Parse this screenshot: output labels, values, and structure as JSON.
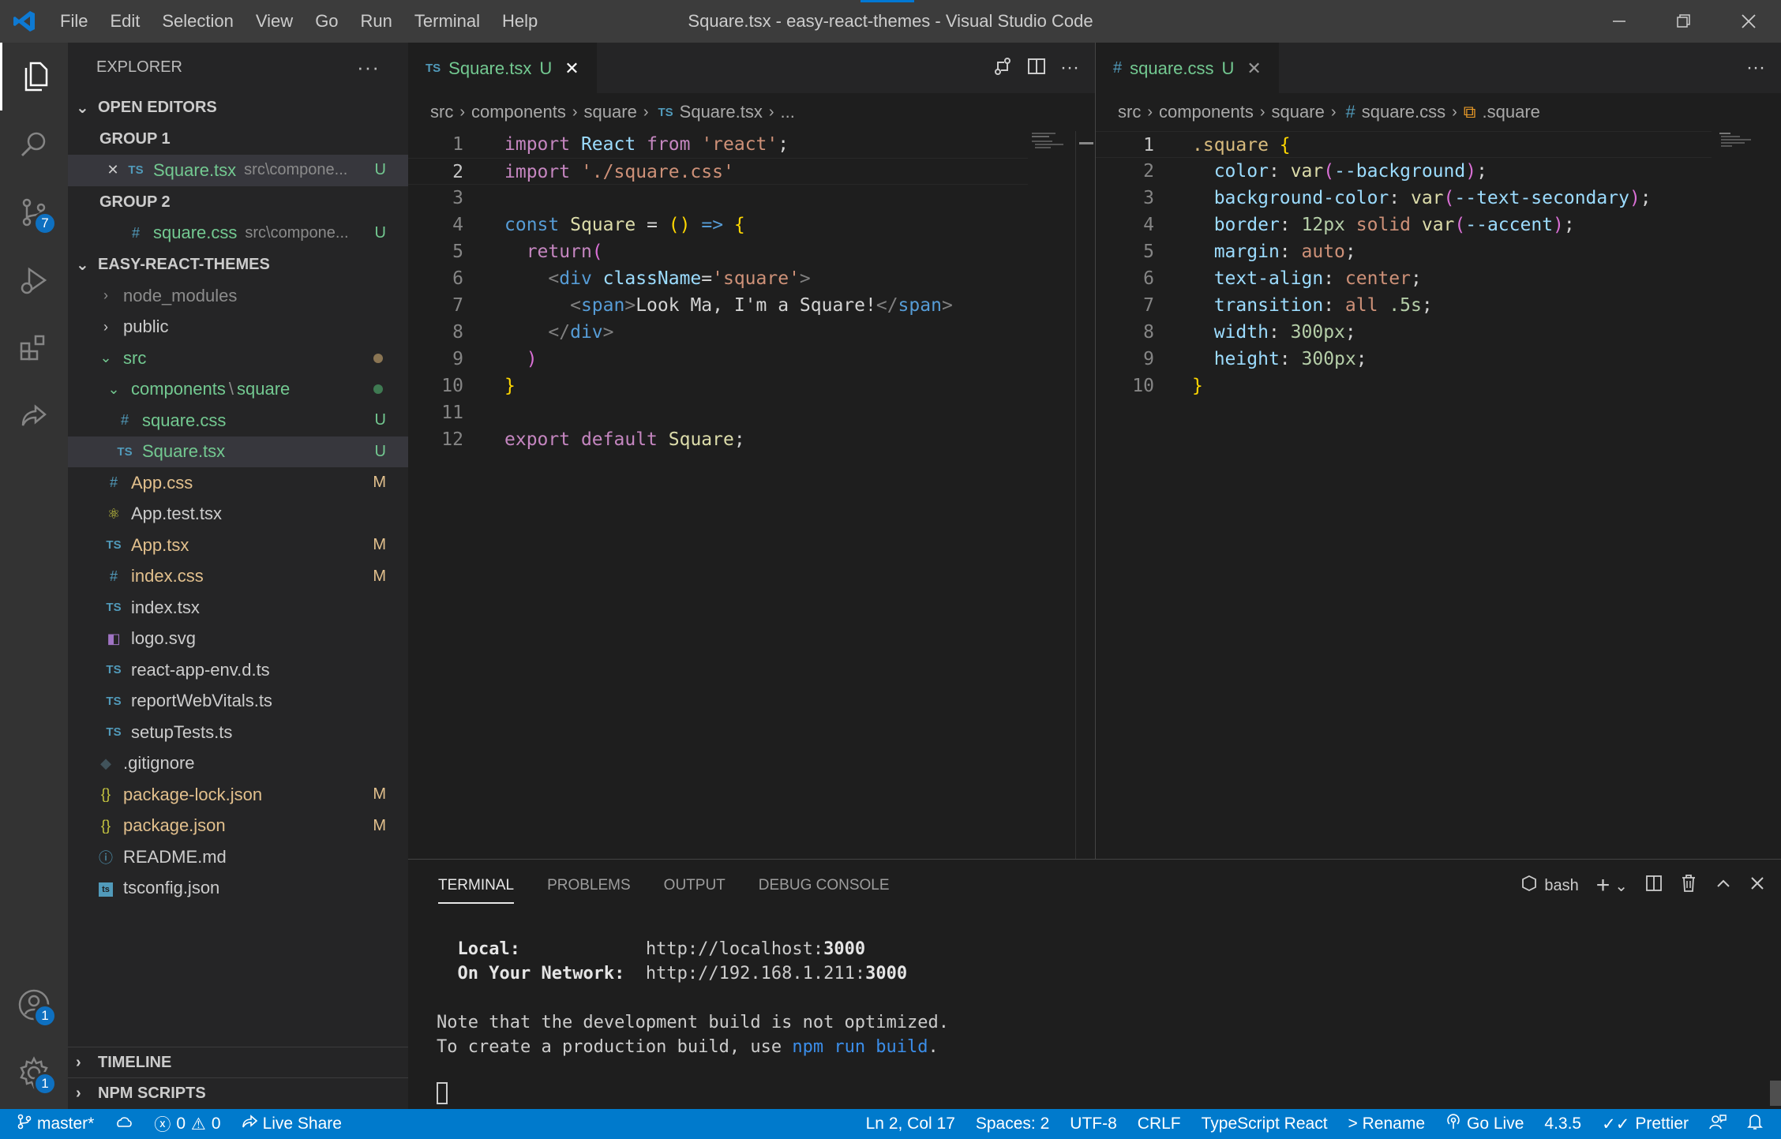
{
  "window": {
    "title": "Square.tsx - easy-react-themes - Visual Studio Code",
    "menu": [
      "File",
      "Edit",
      "Selection",
      "View",
      "Go",
      "Run",
      "Terminal",
      "Help"
    ]
  },
  "activity_bar": {
    "source_control_badge": "7",
    "accounts_badge": "1",
    "settings_badge": "1"
  },
  "sidebar": {
    "title": "EXPLORER",
    "open_editors": {
      "label": "OPEN EDITORS",
      "groups": [
        {
          "label": "GROUP 1",
          "file": "Square.tsx",
          "path": "src\\compone...",
          "status": "U"
        },
        {
          "label": "GROUP 2",
          "file": "square.css",
          "path": "src\\compone...",
          "status": "U"
        }
      ]
    },
    "project": {
      "label": "EASY-REACT-THEMES",
      "items": [
        {
          "name": "node_modules",
          "status": ""
        },
        {
          "name": "public",
          "status": ""
        },
        {
          "name": "src",
          "status": ""
        },
        {
          "name": "components",
          "name2": "square",
          "sep": "\\",
          "status": ""
        },
        {
          "name": "square.css",
          "status": "U"
        },
        {
          "name": "Square.tsx",
          "status": "U"
        },
        {
          "name": "App.css",
          "status": "M"
        },
        {
          "name": "App.test.tsx",
          "status": ""
        },
        {
          "name": "App.tsx",
          "status": "M"
        },
        {
          "name": "index.css",
          "status": "M"
        },
        {
          "name": "index.tsx",
          "status": ""
        },
        {
          "name": "logo.svg",
          "status": ""
        },
        {
          "name": "react-app-env.d.ts",
          "status": ""
        },
        {
          "name": "reportWebVitals.ts",
          "status": ""
        },
        {
          "name": "setupTests.ts",
          "status": ""
        },
        {
          "name": ".gitignore",
          "status": ""
        },
        {
          "name": "package-lock.json",
          "status": "M"
        },
        {
          "name": "package.json",
          "status": "M"
        },
        {
          "name": "README.md",
          "status": ""
        },
        {
          "name": "tsconfig.json",
          "status": ""
        }
      ]
    },
    "timeline": "TIMELINE",
    "npm_scripts": "NPM SCRIPTS"
  },
  "editor1": {
    "tab": {
      "label": "Square.tsx",
      "status": "U",
      "prefix": "TS"
    },
    "breadcrumb": [
      "src",
      "components",
      "square",
      "Square.tsx",
      "..."
    ],
    "line_numbers": [
      "1",
      "2",
      "3",
      "4",
      "5",
      "6",
      "7",
      "8",
      "9",
      "10",
      "11",
      "12"
    ]
  },
  "editor2": {
    "tab": {
      "label": "square.css",
      "status": "U",
      "prefix": "#"
    },
    "breadcrumb": [
      "src",
      "components",
      "square",
      "square.css",
      ".square"
    ],
    "line_numbers": [
      "1",
      "2",
      "3",
      "4",
      "5",
      "6",
      "7",
      "8",
      "9",
      "10"
    ]
  },
  "panel": {
    "tabs": [
      "TERMINAL",
      "PROBLEMS",
      "OUTPUT",
      "DEBUG CONSOLE"
    ],
    "shell": "bash",
    "terminal": {
      "local_label": "Local:",
      "local_url_prefix": "http://localhost:",
      "local_port": "3000",
      "network_label": "On Your Network:",
      "network_url_prefix": "http://192.168.1.211:",
      "network_port": "3000",
      "note_line": "Note that the development build is not optimized.",
      "build_prefix": "To create a production build, use ",
      "build_cmd": "npm run build",
      "build_suffix": "."
    }
  },
  "statusbar": {
    "branch": "master*",
    "errors": "0",
    "warnings": "0",
    "live_share": "Live Share",
    "position": "Ln 2, Col 17",
    "spaces": "Spaces: 2",
    "encoding": "UTF-8",
    "eol": "CRLF",
    "language": "TypeScript React",
    "rename": "> Rename",
    "go_live": "Go Live",
    "version": "4.3.5",
    "prettier": "Prettier"
  },
  "colors": {
    "accent": "#007acc",
    "untracked": "#73c991",
    "modified": "#e2c08d"
  }
}
